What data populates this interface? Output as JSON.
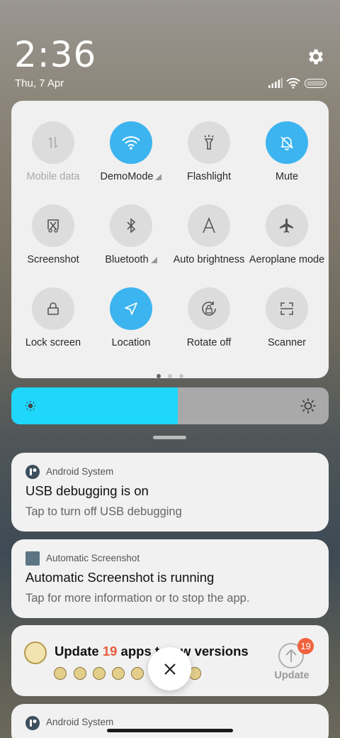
{
  "status": {
    "time": "2:36",
    "date": "Thu, 7 Apr",
    "icons": [
      "settings-icon",
      "signal-icon",
      "wifi-icon",
      "battery-icon"
    ]
  },
  "quick_settings": {
    "tiles": [
      {
        "label": "Mobile data",
        "icon": "mobile-data-icon",
        "state": "disabled",
        "dropdown": false
      },
      {
        "label": "DemoMode",
        "icon": "wifi-icon",
        "state": "on",
        "dropdown": true
      },
      {
        "label": "Flashlight",
        "icon": "flashlight-icon",
        "state": "off",
        "dropdown": false
      },
      {
        "label": "Mute",
        "icon": "mute-bell-icon",
        "state": "on",
        "dropdown": false
      },
      {
        "label": "Screenshot",
        "icon": "screenshot-icon",
        "state": "off",
        "dropdown": false
      },
      {
        "label": "Bluetooth",
        "icon": "bluetooth-icon",
        "state": "off",
        "dropdown": true
      },
      {
        "label": "Auto brightness",
        "icon": "auto-brightness-icon",
        "state": "off",
        "dropdown": false
      },
      {
        "label": "Aeroplane mode",
        "icon": "airplane-icon",
        "state": "off",
        "dropdown": false
      },
      {
        "label": "Lock screen",
        "icon": "lock-icon",
        "state": "off",
        "dropdown": false
      },
      {
        "label": "Location",
        "icon": "location-icon",
        "state": "on",
        "dropdown": false
      },
      {
        "label": "Rotate off",
        "icon": "rotate-lock-icon",
        "state": "off",
        "dropdown": false
      },
      {
        "label": "Scanner",
        "icon": "scanner-icon",
        "state": "off",
        "dropdown": false
      }
    ],
    "pages": 3,
    "active_page": 1
  },
  "brightness": {
    "level": 0.525,
    "accent": "#1fd6fb"
  },
  "notifications": [
    {
      "app": "Android System",
      "title": "USB debugging is on",
      "text": "Tap to turn off USB debugging"
    },
    {
      "app": "Automatic Screenshot",
      "title": "Automatic Screenshot is running",
      "text": "Tap for more information or to stop the app."
    },
    {
      "title_pre": "Update ",
      "count": "19",
      "title_post": " apps t",
      "title_tail": "w versions",
      "button_label": "Update",
      "badge": "19"
    },
    {
      "app": "Android System"
    }
  ],
  "colors": {
    "accent": "#3cb4ef",
    "badge": "#f0623e"
  }
}
